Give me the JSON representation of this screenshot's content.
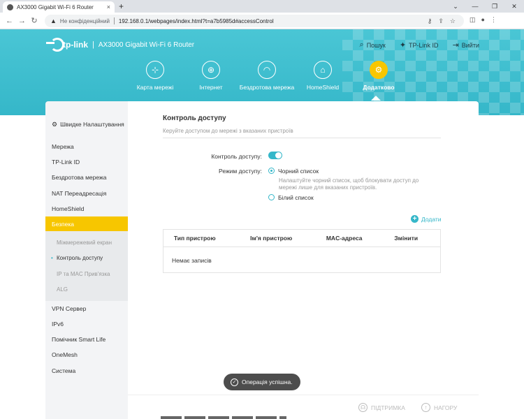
{
  "browser": {
    "tab_title": "AX3000 Gigabit Wi-Fi 6 Router",
    "tab_close": "×",
    "new_tab": "+",
    "not_secure": "Не конфіденційний",
    "url": "192.168.0.1/webpages/index.html?t=a7b5985d#accessControl"
  },
  "header": {
    "brand": "tp-link",
    "separator": "|",
    "model": "AX3000 Gigabit Wi-Fi 6 Router",
    "search": "Пошук",
    "tplink_id": "TP-Link ID",
    "logout": "Вийти"
  },
  "nav": [
    {
      "label": "Карта мережі",
      "icon": "network-map-icon"
    },
    {
      "label": "Інтернет",
      "icon": "globe-icon"
    },
    {
      "label": "Бездротова мережа",
      "icon": "wifi-icon"
    },
    {
      "label": "HomeShield",
      "icon": "homeshield-icon"
    },
    {
      "label": "Додатково",
      "icon": "gear-icon",
      "active": true
    }
  ],
  "sidebar": {
    "quick_setup": "Швидке Налаштування",
    "items": [
      "Мережа",
      "TP-Link ID",
      "Бездротова мережа",
      "NAT Переадресація",
      "HomeShield",
      "Безпека"
    ],
    "sub_items": [
      "Міжмережевий екран",
      "Контроль доступу",
      "IP та MAC Прив'язка",
      "ALG"
    ],
    "items_after": [
      "VPN Сервер",
      "IPv6",
      "Помічник Smart Life",
      "OneMesh",
      "Система"
    ]
  },
  "content": {
    "title": "Контроль доступу",
    "description": "Керуйте доступом до мережі з вказаних пристроїв",
    "access_control_label": "Контроль доступу:",
    "access_control_enabled": true,
    "mode_label": "Режим доступу:",
    "blacklist": "Чорний список",
    "blacklist_hint": "Налаштуйте чорний список, щоб блокувати доступ до мережі лише для вказаних пристроїв.",
    "whitelist": "Білий список",
    "selected_mode": "blacklist",
    "add": "Додати",
    "table": {
      "columns": [
        "Тип пристрою",
        "Ім'я пристрою",
        "MAC-адреса",
        "Змінити"
      ],
      "empty": "Немає записів"
    }
  },
  "toast": "Операція успішна.",
  "footer": {
    "support": "ПІДТРИМКА",
    "top": "НАГОРУ"
  },
  "colors": {
    "accent": "#35b7c9",
    "active": "#f7c600"
  }
}
